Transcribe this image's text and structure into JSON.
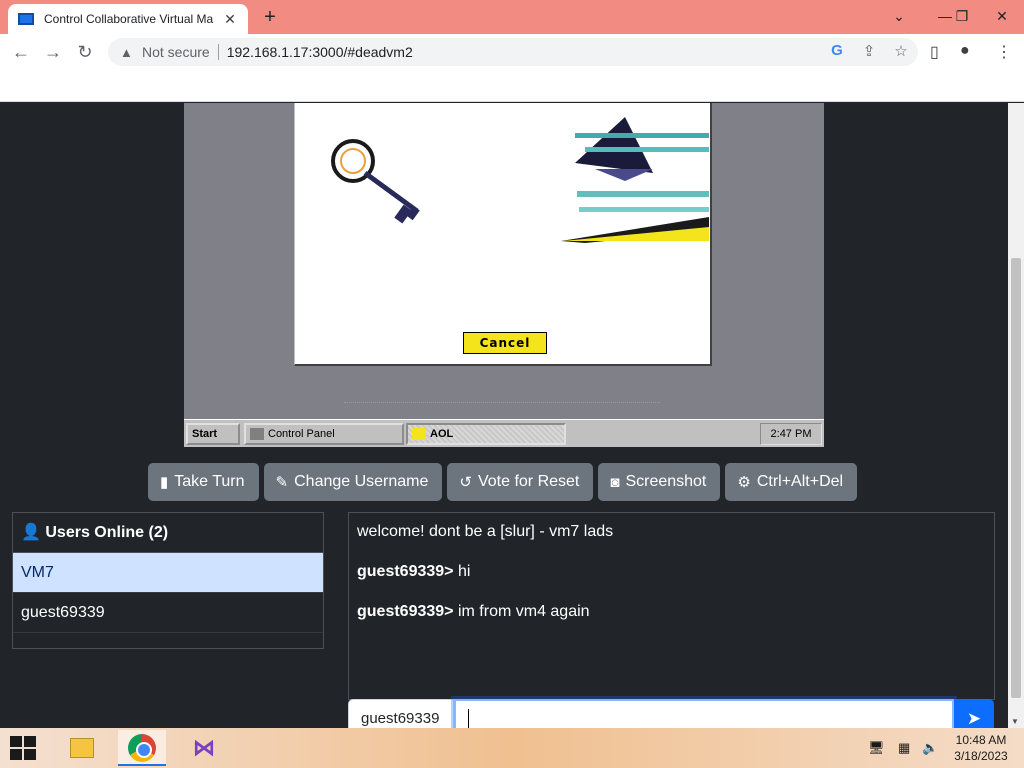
{
  "browser": {
    "tab_title": "Control Collaborative Virtual Ma",
    "new_tab": "+",
    "not_secure": "Not secure",
    "url": "192.168.1.17:3000/#deadvm2"
  },
  "vm": {
    "dialog": {
      "cancel_label": "Cancel"
    },
    "taskbar": {
      "start_label": "Start",
      "tasks": [
        "Control Panel",
        "AOL"
      ],
      "clock": "2:47 PM"
    }
  },
  "buttons": {
    "take_turn": "Take Turn",
    "change_username": "Change Username",
    "vote_reset": "Vote for Reset",
    "screenshot": "Screenshot",
    "ctrl_alt_del": "Ctrl+Alt+Del"
  },
  "users": {
    "header": "Users Online (2)",
    "list": [
      "VM7",
      "guest69339"
    ]
  },
  "chat": {
    "messages": [
      {
        "user": "",
        "text": "welcome! dont be a [slur] - vm7 lads"
      },
      {
        "user": "guest69339>",
        "text": " hi"
      },
      {
        "user": "guest69339>",
        "text": " im from vm4 again"
      }
    ],
    "username": "guest69339",
    "input_value": ""
  },
  "taskbar": {
    "time": "10:48 AM",
    "date": "3/18/2023"
  }
}
